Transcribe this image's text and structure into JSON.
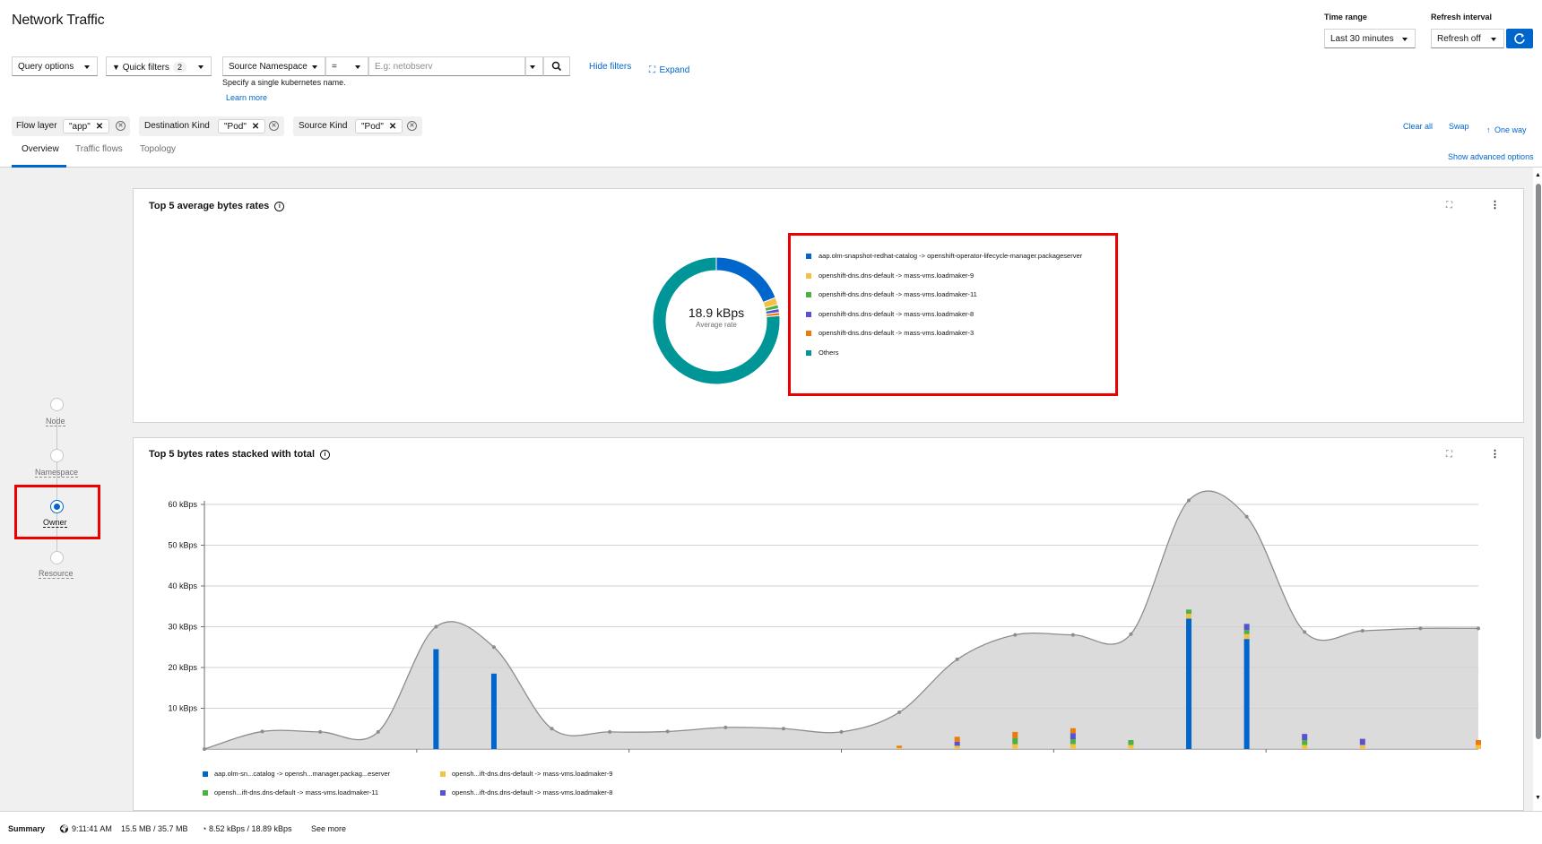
{
  "page": {
    "title": "Network Traffic"
  },
  "controls": {
    "time_range_label": "Time range",
    "time_range_value": "Last 30 minutes",
    "refresh_label": "Refresh interval",
    "refresh_value": "Refresh off",
    "query_options": "Query options",
    "quick_filters": "Quick filters",
    "quick_filters_count": "2",
    "filter_field": "Source Namespace",
    "filter_op": "=",
    "filter_placeholder": "E.g: netobserv",
    "hide_filters": "Hide filters",
    "expand": "Expand",
    "hint": "Specify a single kubernetes name.",
    "learn_more": "Learn more"
  },
  "chips": [
    {
      "category": "Flow layer",
      "value": "\"app\""
    },
    {
      "category": "Destination Kind",
      "value": "\"Pod\""
    },
    {
      "category": "Source Kind",
      "value": "\"Pod\""
    }
  ],
  "chip_actions": {
    "clear_all": "Clear all",
    "swap": "Swap",
    "one_way": "One way"
  },
  "tabs": [
    {
      "label": "Overview",
      "active": true
    },
    {
      "label": "Traffic flows",
      "active": false
    },
    {
      "label": "Topology",
      "active": false
    }
  ],
  "show_advanced": "Show advanced options",
  "scope_steps": [
    {
      "label": "Node",
      "selected": false
    },
    {
      "label": "Namespace",
      "selected": false
    },
    {
      "label": "Owner",
      "selected": true
    },
    {
      "label": "Resource",
      "selected": false
    }
  ],
  "donut_panel": {
    "title": "Top 5 average bytes rates",
    "center_value": "18.9 kBps",
    "center_label": "Average rate"
  },
  "stacked_panel": {
    "title": "Top 5 bytes rates stacked with total"
  },
  "colors": {
    "blue": "#0066cc",
    "yellow": "#f4c145",
    "green": "#4cb140",
    "purple": "#5752d1",
    "orange": "#ec7a08",
    "teal": "#009596",
    "total_area": "#d2d2d2"
  },
  "chart_data": [
    {
      "type": "pie",
      "title": "Top 5 average bytes rates",
      "labels": [
        "aap.olm-snapshot-redhat-catalog -> openshift-operator-lifecycle-manager.packageserver",
        "openshift-dns.dns-default -> mass-vms.loadmaker-9",
        "openshift-dns.dns-default -> mass-vms.loadmaker-11",
        "openshift-dns.dns-default -> mass-vms.loadmaker-8",
        "openshift-dns.dns-default -> mass-vms.loadmaker-3",
        "Others"
      ],
      "values": [
        3.6,
        0.35,
        0.2,
        0.18,
        0.15,
        14.42
      ],
      "colors": [
        "#0066cc",
        "#f4c145",
        "#4cb140",
        "#5752d1",
        "#ec7a08",
        "#009596"
      ],
      "legend": "right"
    },
    {
      "type": "area",
      "title": "Top 5 bytes rates stacked with total",
      "ylabel": "",
      "ylim": [
        0,
        60
      ],
      "yticks": [
        "10 kBps",
        "20 kBps",
        "30 kBps",
        "40 kBps",
        "50 kBps",
        "60 kBps"
      ],
      "grid": true,
      "x": [
        0,
        1,
        2,
        3,
        4,
        5,
        6,
        7,
        8,
        9,
        10,
        11,
        12,
        13,
        14,
        15,
        16,
        17,
        18,
        19,
        20,
        21,
        22
      ],
      "total": [
        0,
        4.3,
        4.2,
        4.2,
        30,
        25,
        5,
        4.2,
        4.3,
        5.3,
        5,
        4.2,
        9,
        22,
        28,
        28,
        28.2,
        61,
        57,
        28.7,
        29,
        29.6,
        29.6
      ],
      "series": [
        {
          "name": "aap.olm-sn...catalog -> opensh...manager.packag...eserver",
          "color": "#0066cc",
          "values": [
            0,
            0,
            0,
            0,
            24.5,
            18.5,
            0,
            0,
            0,
            0,
            0,
            0,
            0,
            0,
            0,
            0,
            0,
            32,
            27,
            0,
            0,
            0,
            0
          ]
        },
        {
          "name": "opensh...ift-dns.dns-default -> mass-vms.loadmaker-9",
          "color": "#f4c145",
          "values": [
            0,
            0,
            0,
            0,
            0,
            0,
            0,
            0,
            0,
            0,
            0,
            0,
            0.3,
            0.8,
            1.2,
            1.2,
            1.0,
            1.2,
            1.2,
            1.0,
            1.0,
            0,
            1.0
          ]
        },
        {
          "name": "opensh...ift-dns.dns-default -> mass-vms.loadmaker-11",
          "color": "#4cb140",
          "values": [
            0,
            0,
            0,
            0,
            0,
            0,
            0,
            0,
            0,
            0,
            0,
            0,
            0,
            0,
            1.5,
            1.2,
            1.2,
            1.0,
            1.0,
            1.2,
            0,
            0,
            0
          ]
        },
        {
          "name": "opensh...ift-dns.dns-default -> mass-vms.loadmaker-8",
          "color": "#5752d1",
          "values": [
            0,
            0,
            0,
            0,
            0,
            0,
            0,
            0,
            0,
            0,
            0,
            0,
            0,
            1.0,
            0,
            1.5,
            0,
            0,
            1.5,
            1.5,
            1.5,
            0,
            0
          ]
        },
        {
          "name": "",
          "color": "#ec7a08",
          "values": [
            0,
            0,
            0,
            0,
            0,
            0,
            0,
            0,
            0,
            0,
            0,
            0,
            0.5,
            1.2,
            1.5,
            1.2,
            0,
            0,
            0,
            0,
            0,
            0,
            1.2
          ]
        }
      ],
      "legend": "bottom"
    }
  ],
  "footer": {
    "summary": "Summary",
    "time": "9:11:41 AM",
    "size": "15.5 MB / 35.7 MB",
    "rate": "8.52 kBps / 18.89 kBps",
    "see_more": "See more"
  }
}
